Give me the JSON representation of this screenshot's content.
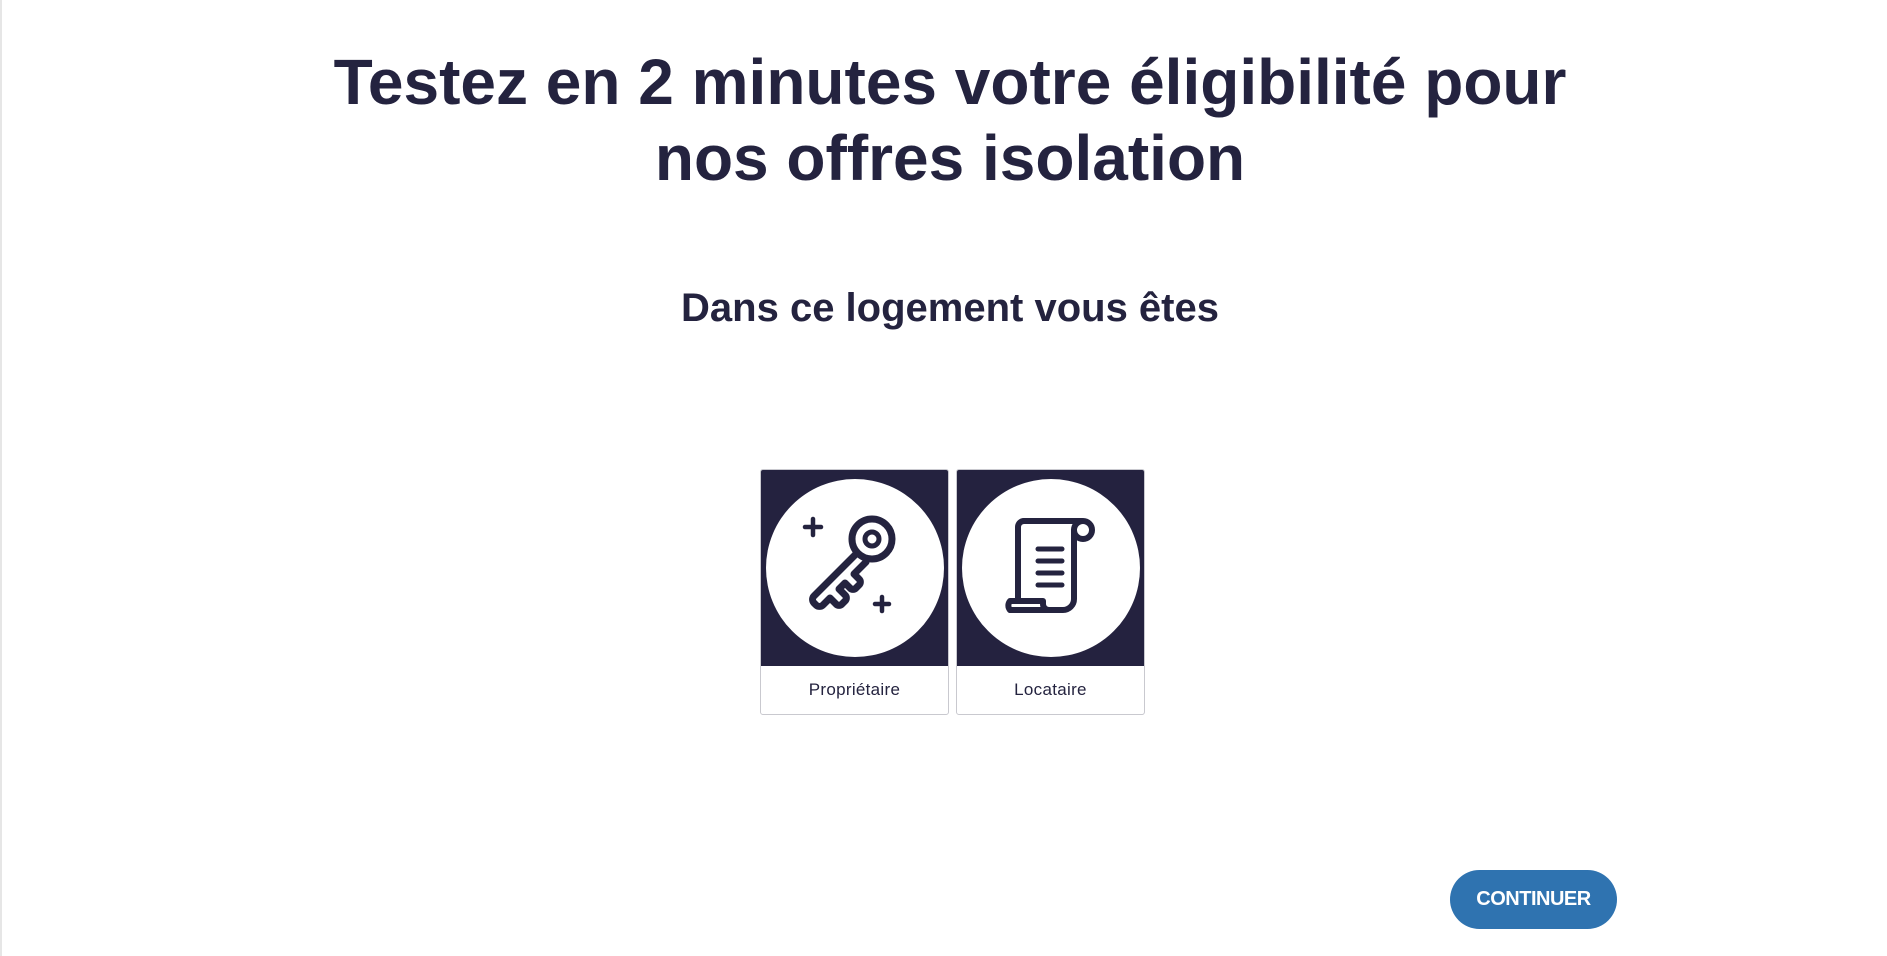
{
  "header": {
    "title_line1": "Testez en 2 minutes votre éligibilité pour",
    "title_line2": "nos offres isolation"
  },
  "question": {
    "text": "Dans ce logement vous êtes"
  },
  "options": [
    {
      "label": "Propriétaire",
      "icon": "key-icon"
    },
    {
      "label": "Locataire",
      "icon": "scroll-icon"
    }
  ],
  "actions": {
    "continue_label": "CONTINUER"
  },
  "colors": {
    "text_dark": "#24233f",
    "card_background": "#24223f",
    "button_blue": "#2f73b0"
  }
}
